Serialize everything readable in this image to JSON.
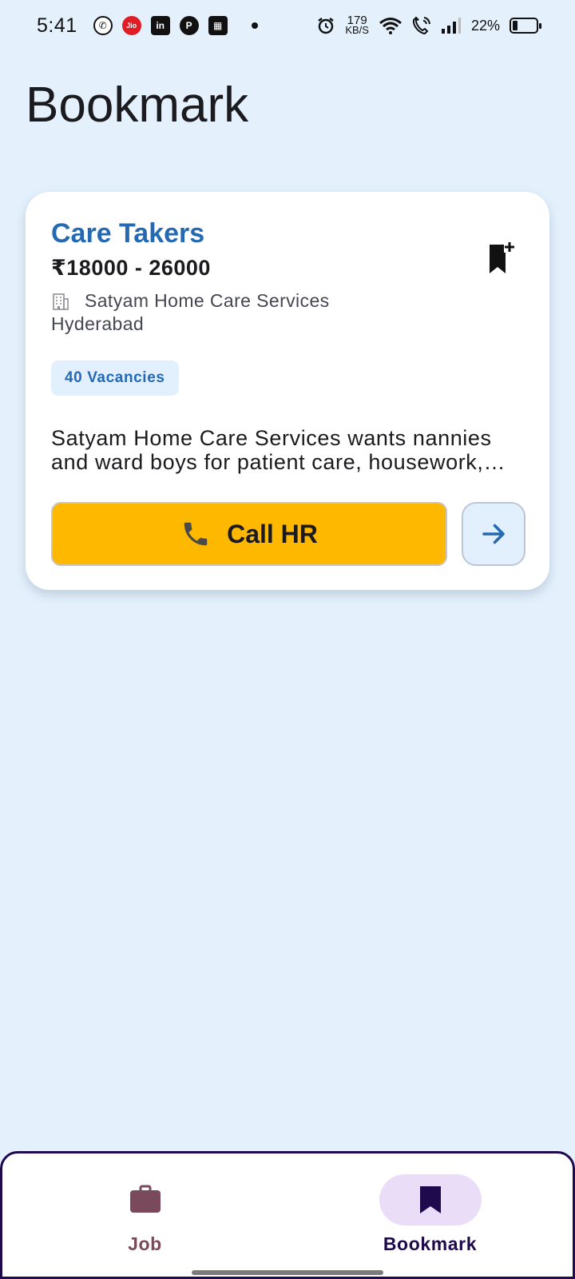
{
  "status_bar": {
    "time": "5:41",
    "net_speed_value": "179",
    "net_speed_unit": "KB/S",
    "battery_percent": "22%",
    "app_icons": [
      "whatsapp-icon",
      "jio-icon",
      "linkedin-icon",
      "app-icon",
      "calendar-icon"
    ]
  },
  "page": {
    "title": "Bookmark"
  },
  "job_card": {
    "title": "Care Takers",
    "salary": "₹18000 - 26000",
    "company": "Satyam Home Care Services",
    "location": "Hyderabad",
    "vacancies": "40 Vacancies",
    "description": "Satyam Home Care Services wants nannies and ward boys for patient care, housework, and cooking duties.",
    "call_button_label": "Call HR",
    "bookmarked": true
  },
  "bottom_nav": {
    "items": [
      {
        "label": "Job",
        "icon": "briefcase-icon",
        "active": false
      },
      {
        "label": "Bookmark",
        "icon": "bookmark-icon",
        "active": true
      }
    ]
  },
  "colors": {
    "background": "#e4f1fd",
    "accent_blue": "#2469b2",
    "call_button": "#ffb800",
    "nav_border": "#1e0a4d",
    "nav_active_pill": "#e9ddf7"
  }
}
